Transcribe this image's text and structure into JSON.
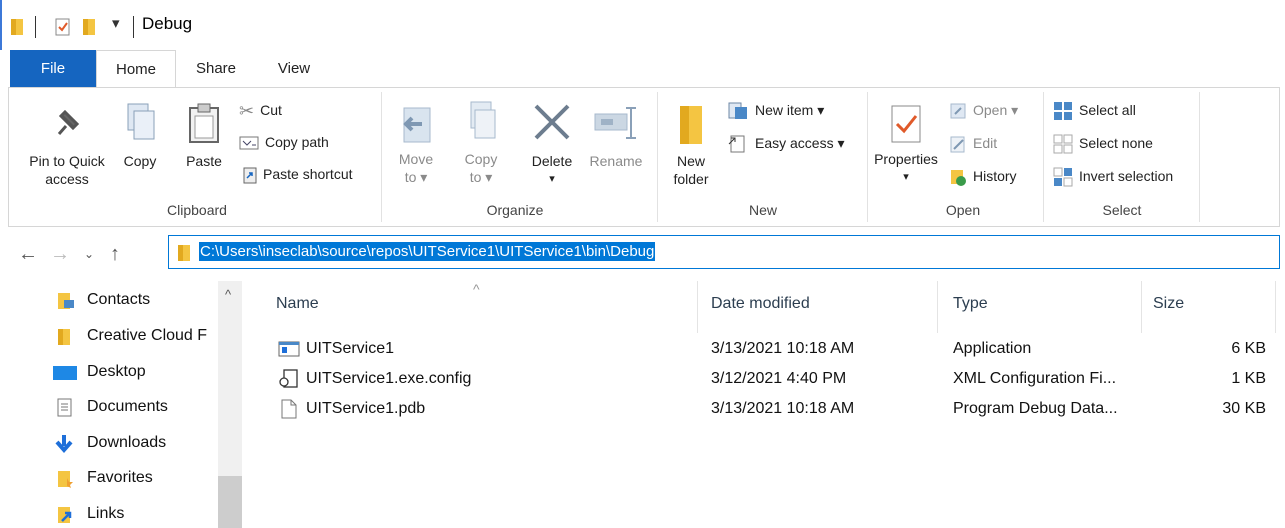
{
  "window": {
    "title": "Debug",
    "qa_dropdown": "▾"
  },
  "tabs": [
    {
      "label": "File"
    },
    {
      "label": "Home"
    },
    {
      "label": "Share"
    },
    {
      "label": "View"
    }
  ],
  "ribbon": {
    "clipboard": {
      "group_label": "Clipboard",
      "pin_label_1": "Pin to Quick",
      "pin_label_2": "access",
      "copy_label": "Copy",
      "paste_label": "Paste",
      "cut_label": "Cut",
      "copy_path_label": "Copy path",
      "paste_shortcut_label": "Paste shortcut"
    },
    "organize": {
      "group_label": "Organize",
      "move_label_1": "Move",
      "move_label_2": "to ▾",
      "copy_label_1": "Copy",
      "copy_label_2": "to ▾",
      "delete_label": "Delete",
      "delete_arrow": "▾",
      "rename_label": "Rename"
    },
    "new": {
      "group_label": "New",
      "new_folder_1": "New",
      "new_folder_2": "folder",
      "new_item_label": "New item ▾",
      "easy_access_label": "Easy access ▾"
    },
    "open": {
      "group_label": "Open",
      "properties_label": "Properties",
      "properties_arrow": "▾",
      "open_label": "Open ▾",
      "edit_label": "Edit",
      "history_label": "History"
    },
    "select": {
      "group_label": "Select",
      "select_all_label": "Select all",
      "select_none_label": "Select none",
      "invert_label": "Invert selection"
    }
  },
  "address": {
    "path": "C:\\Users\\inseclab\\source\\repos\\UITService1\\UITService1\\bin\\Debug"
  },
  "nav": {
    "items": [
      {
        "label": "Contacts",
        "icon": "contacts-folder-icon"
      },
      {
        "label": "Creative Cloud F",
        "icon": "folder-icon"
      },
      {
        "label": "Desktop",
        "icon": "desktop-icon"
      },
      {
        "label": "Documents",
        "icon": "documents-icon"
      },
      {
        "label": "Downloads",
        "icon": "downloads-icon"
      },
      {
        "label": "Favorites",
        "icon": "favorites-icon"
      },
      {
        "label": "Links",
        "icon": "links-icon"
      }
    ],
    "scroll_up": "^"
  },
  "files": {
    "columns": {
      "name": "Name",
      "date": "Date modified",
      "type": "Type",
      "size": "Size"
    },
    "sort_indicator": "^",
    "rows": [
      {
        "name": "UITService1",
        "date": "3/13/2021 10:18 AM",
        "type": "Application",
        "size": "6 KB",
        "icon": "application-icon"
      },
      {
        "name": "UITService1.exe.config",
        "date": "3/12/2021 4:40 PM",
        "type": "XML Configuration Fi...",
        "size": "1 KB",
        "icon": "config-file-icon"
      },
      {
        "name": "UITService1.pdb",
        "date": "3/13/2021 10:18 AM",
        "type": "Program Debug Data...",
        "size": "30 KB",
        "icon": "file-icon"
      }
    ]
  },
  "colors": {
    "accent": "#0078d7",
    "file_tab": "#1565c0",
    "folder": "#f4c542"
  }
}
